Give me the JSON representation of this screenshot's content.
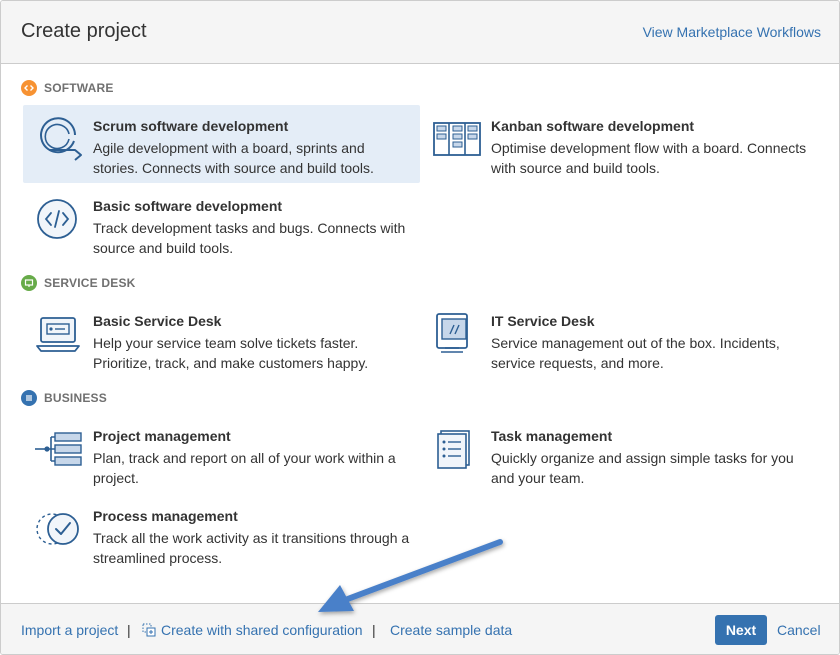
{
  "header": {
    "title": "Create project",
    "marketplace_link": "View Marketplace Workflows"
  },
  "sections": [
    {
      "label": "SOFTWARE",
      "color": "#f79232",
      "icon": "code-icon"
    },
    {
      "label": "SERVICE DESK",
      "color": "#67ab49",
      "icon": "monitor-icon"
    },
    {
      "label": "BUSINESS",
      "color": "#3572b0",
      "icon": "list-icon"
    }
  ],
  "projects": {
    "scrum": {
      "name": "Scrum software development",
      "desc": "Agile development with a board, sprints and stories. Connects with source and build tools.",
      "selected": true,
      "icon": "scrum-cycle-icon"
    },
    "kanban": {
      "name": "Kanban software development",
      "desc": "Optimise development flow with a board. Connects with source and build tools.",
      "icon": "kanban-board-icon"
    },
    "basic_software": {
      "name": "Basic software development",
      "desc": "Track development tasks and bugs. Connects with source and build tools.",
      "icon": "code-circle-icon"
    },
    "basic_service_desk": {
      "name": "Basic Service Desk",
      "desc": "Help your service team solve tickets faster. Prioritize, track, and make customers happy.",
      "icon": "laptop-ticket-icon"
    },
    "it_service_desk": {
      "name": "IT Service Desk",
      "desc": "Service management out of the box. Incidents, service requests, and more.",
      "icon": "desktop-monitor-icon"
    },
    "project_mgmt": {
      "name": "Project management",
      "desc": "Plan, track and report on all of your work within a project.",
      "icon": "hierarchy-icon"
    },
    "task_mgmt": {
      "name": "Task management",
      "desc": "Quickly organize and assign simple tasks for you and your team.",
      "icon": "checklist-icon"
    },
    "process_mgmt": {
      "name": "Process management",
      "desc": "Track all the work activity as it transitions through a streamlined process.",
      "icon": "process-check-icon"
    }
  },
  "footer": {
    "import": "Import a project",
    "shared_config": "Create with shared configuration",
    "sample_data": "Create sample data",
    "separator": "|",
    "next": "Next",
    "cancel": "Cancel"
  },
  "colors": {
    "accent": "#3572b0",
    "selected_bg": "#e4edf7",
    "icon_stroke": "#2d5f93",
    "annotation_arrow": "#4a80c9"
  }
}
